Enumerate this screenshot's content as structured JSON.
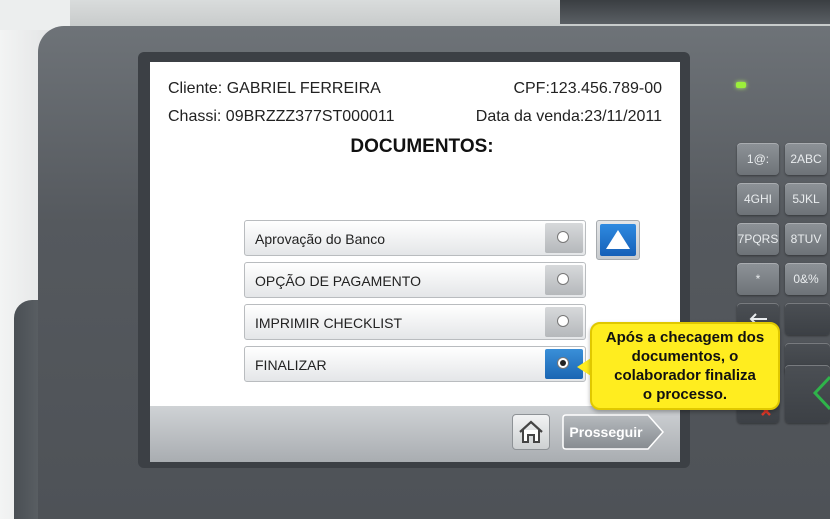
{
  "header": {
    "client": "Cliente: GABRIEL FERREIRA",
    "cpf": "CPF:123.456.789-00",
    "chassis": "Chassi: 09BRZZZ377ST000011",
    "sale_date": "Data da venda:23/11/2011",
    "title": "DOCUMENTOS:"
  },
  "options": [
    {
      "label": "Aprovação do Banco",
      "selected": false
    },
    {
      "label": "OPÇÃO DE PAGAMENTO",
      "selected": false
    },
    {
      "label": "IMPRIMIR CHECKLIST",
      "selected": false
    },
    {
      "label": "FINALIZAR",
      "selected": true
    }
  ],
  "footer": {
    "next_label": "Prosseguir"
  },
  "callout": {
    "line1": "Após a checagem dos",
    "line2": "documentos, o",
    "line3": "colaborador finaliza",
    "line4": "o processo."
  },
  "keypad": [
    {
      "label": "1@:"
    },
    {
      "label": "2ABC"
    },
    {
      "label": "4GHI"
    },
    {
      "label": "5JKL"
    },
    {
      "label": "7PQRS"
    },
    {
      "label": "8TUV"
    },
    {
      "label": "*"
    },
    {
      "label": "0&%"
    }
  ],
  "colors": {
    "accent_blue": "#1a66b3",
    "callout_yellow": "#ffed1f",
    "status_led": "#9cf03a"
  }
}
